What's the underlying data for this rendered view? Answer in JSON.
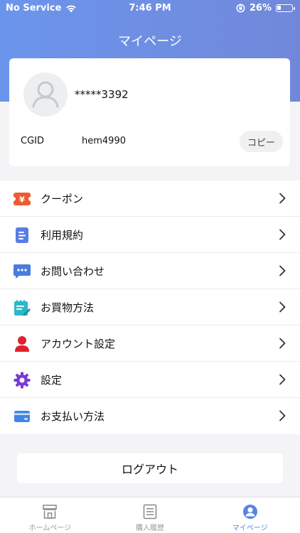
{
  "status": {
    "carrier": "No Service",
    "time": "7:46 PM",
    "battery": "26%",
    "battery_level": 0.26
  },
  "header": {
    "title": "マイページ"
  },
  "profile": {
    "username": "*****3392",
    "cgid_label": "CGID",
    "cgid_value": "hem4990",
    "copy_label": "コピー"
  },
  "menu": {
    "items": [
      {
        "label": "クーポン",
        "icon": "coupon-icon"
      },
      {
        "label": "利用規約",
        "icon": "document-icon"
      },
      {
        "label": "お問い合わせ",
        "icon": "chat-icon"
      },
      {
        "label": "お買物方法",
        "icon": "notepad-icon"
      },
      {
        "label": "アカウント設定",
        "icon": "account-icon"
      },
      {
        "label": "設定",
        "icon": "gear-icon"
      },
      {
        "label": "お支払い方法",
        "icon": "credit-card-icon"
      }
    ]
  },
  "logout_label": "ログアウト",
  "tabs": [
    {
      "label": "ホームページ",
      "icon": "store-icon",
      "active": false
    },
    {
      "label": "購入履歴",
      "icon": "list-icon",
      "active": false
    },
    {
      "label": "マイページ",
      "icon": "profile-icon",
      "active": true
    }
  ],
  "colors": {
    "header_gradient_start": "#6b95ec",
    "header_gradient_end": "#7188da",
    "active_tab": "#5a83e3",
    "coupon": "#f05a32",
    "document": "#5b7ce8",
    "chat": "#4a7cde",
    "notepad": "#2ab9c9",
    "account": "#e0212f",
    "gear": "#7a3ad6",
    "card": "#3f86e8"
  }
}
